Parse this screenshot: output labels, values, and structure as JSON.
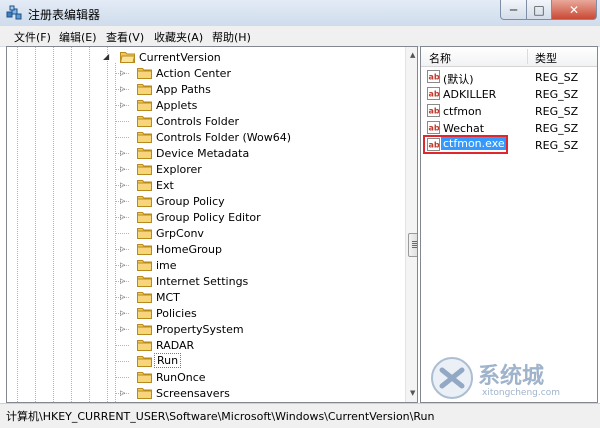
{
  "window": {
    "title": "注册表编辑器",
    "controls": {
      "minimize": "─",
      "maximize": "□",
      "close": "✕"
    }
  },
  "menu": [
    "文件(F)",
    "编辑(E)",
    "查看(V)",
    "收藏夹(A)",
    "帮助(H)"
  ],
  "tree": {
    "parent": "CurrentVersion",
    "items": [
      {
        "label": "Action Center",
        "expandable": true
      },
      {
        "label": "App Paths",
        "expandable": true
      },
      {
        "label": "Applets",
        "expandable": true
      },
      {
        "label": "Controls Folder",
        "expandable": false
      },
      {
        "label": "Controls Folder (Wow64)",
        "expandable": false
      },
      {
        "label": "Device Metadata",
        "expandable": true
      },
      {
        "label": "Explorer",
        "expandable": true
      },
      {
        "label": "Ext",
        "expandable": true
      },
      {
        "label": "Group Policy",
        "expandable": true
      },
      {
        "label": "Group Policy Editor",
        "expandable": true
      },
      {
        "label": "GrpConv",
        "expandable": false
      },
      {
        "label": "HomeGroup",
        "expandable": true
      },
      {
        "label": "ime",
        "expandable": true
      },
      {
        "label": "Internet Settings",
        "expandable": true
      },
      {
        "label": "MCT",
        "expandable": true
      },
      {
        "label": "Policies",
        "expandable": true
      },
      {
        "label": "PropertySystem",
        "expandable": true
      },
      {
        "label": "RADAR",
        "expandable": false
      },
      {
        "label": "Run",
        "expandable": false,
        "selected": true
      },
      {
        "label": "RunOnce",
        "expandable": false
      },
      {
        "label": "Screensavers",
        "expandable": true
      }
    ]
  },
  "list": {
    "headers": {
      "name": "名称",
      "type": "类型"
    },
    "rows": [
      {
        "name": "(默认)",
        "type": "REG_SZ"
      },
      {
        "name": "ADKILLER",
        "type": "REG_SZ"
      },
      {
        "name": "ctfmon",
        "type": "REG_SZ"
      },
      {
        "name": "Wechat",
        "type": "REG_SZ"
      },
      {
        "name": "ctfmon.exe",
        "type": "REG_SZ",
        "highlight": true
      }
    ]
  },
  "status": "计算机\\HKEY_CURRENT_USER\\Software\\Microsoft\\Windows\\CurrentVersion\\Run",
  "watermark": {
    "brand": "系统城",
    "site": "xitongcheng.com"
  },
  "colors": {
    "selection": "#3399ff",
    "highlight_box": "#e0262e",
    "folder": "#f2c75c"
  }
}
